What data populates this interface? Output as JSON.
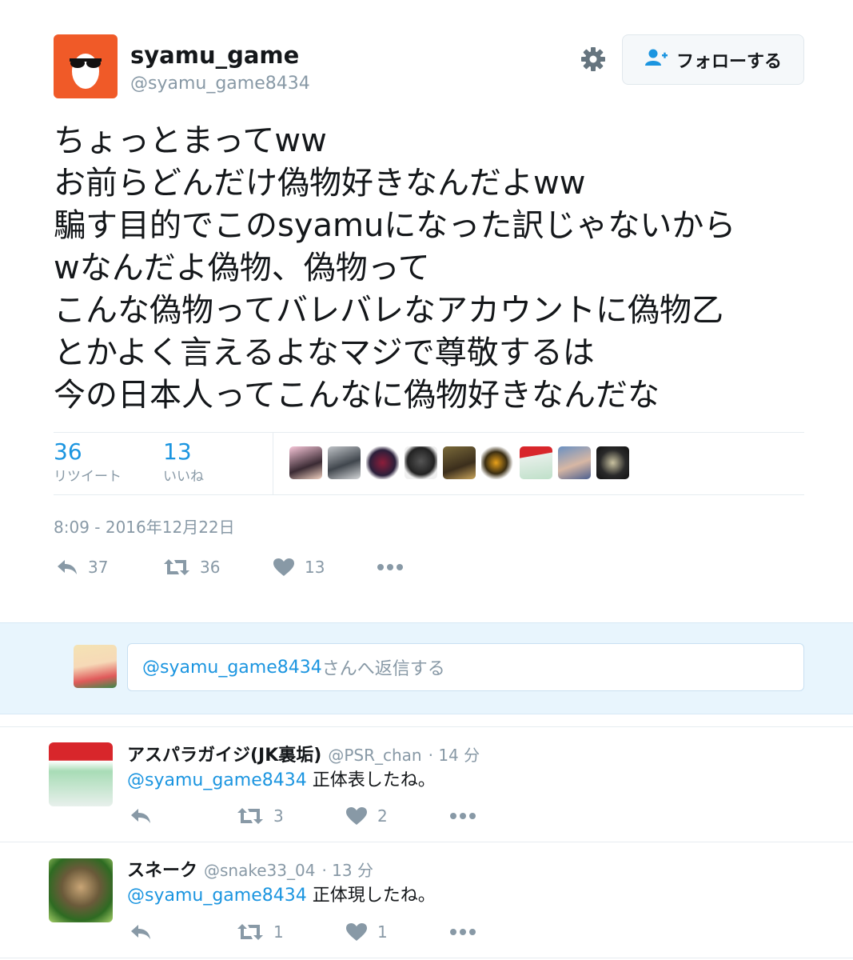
{
  "tweet": {
    "display_name": "syamu_game",
    "handle": "@syamu_game8434",
    "follow_label": "フォローする",
    "lines": [
      "ちょっとまってww",
      "お前らどんだけ偽物好きなんだよww",
      "騙す目的でこのsyamuになった訳じゃないから",
      "wなんだよ偽物、偽物って",
      "こんな偽物ってバレバレなアカウントに偽物乙",
      "とかよく言えるよなマジで尊敬するは",
      "今の日本人ってこんなに偽物好きなんだな"
    ],
    "retweets": {
      "count": "36",
      "label": "リツイート"
    },
    "likes": {
      "count": "13",
      "label": "いいね"
    },
    "timestamp": "8:09 - 2016年12月22日",
    "actions": {
      "reply": "37",
      "retweet": "36",
      "like": "13"
    }
  },
  "reply_box": {
    "mention": "@syamu_game8434",
    "suffix": "さんへ返信する"
  },
  "replies": [
    {
      "name": "アスパラガイジ(JK裏垢)",
      "handle": "@PSR_chan",
      "time": "· 14 分",
      "mention": "@syamu_game8434",
      "text": " 正体表したね。",
      "retweets": "3",
      "likes": "2"
    },
    {
      "name": "スネーク",
      "handle": "@snake33_04",
      "time": "· 13 分",
      "mention": "@syamu_game8434",
      "text": " 正体現したね。",
      "retweets": "1",
      "likes": "1"
    }
  ],
  "colors": {
    "accent": "#1b95e0",
    "muted": "#8899a6",
    "avatar_bg": "#f05a28",
    "reply_bg": "#e8f5fd"
  },
  "icons": [
    "sunglasses-egg-avatar",
    "gear-icon",
    "add-user-icon",
    "reply-icon",
    "retweet-icon",
    "heart-icon",
    "more-icon"
  ]
}
